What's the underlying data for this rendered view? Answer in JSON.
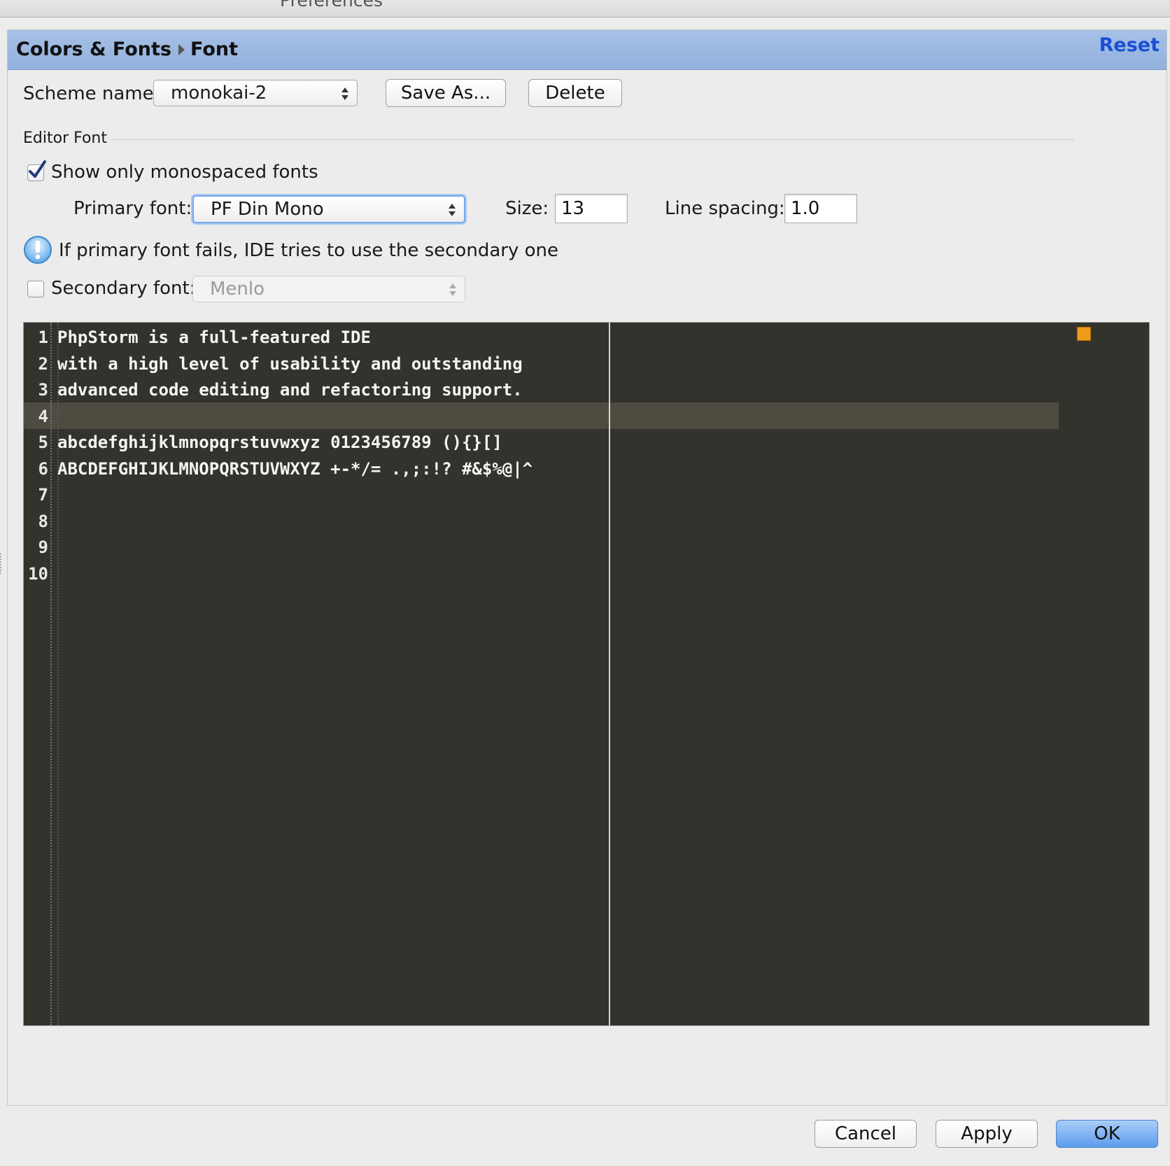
{
  "window": {
    "title": "Preferences"
  },
  "header": {
    "breadcrumb": [
      "Colors & Fonts",
      "Font"
    ],
    "reset_label": "Reset"
  },
  "scheme": {
    "label": "Scheme name:",
    "value": "monokai-2",
    "save_as_label": "Save As...",
    "delete_label": "Delete"
  },
  "editor_font": {
    "section_title": "Editor Font",
    "show_mono_label": "Show only monospaced fonts",
    "show_mono_checked": true,
    "primary_font_label": "Primary font:",
    "primary_font_value": "PF Din Mono",
    "size_label": "Size:",
    "size_value": "13",
    "line_spacing_label": "Line spacing:",
    "line_spacing_value": "1.0",
    "info_text": "If primary font fails, IDE tries to use the secondary one",
    "secondary_font_label": "Secondary font:",
    "secondary_font_checked": false,
    "secondary_font_value": "Menlo"
  },
  "preview": {
    "background": "#32332d",
    "caret_row_color": "#4e4b40",
    "lines": [
      {
        "n": "1",
        "text": "PhpStorm is a full-featured IDE"
      },
      {
        "n": "2",
        "text": "with a high level of usability and outstanding"
      },
      {
        "n": "3",
        "text": "advanced code editing and refactoring support."
      },
      {
        "n": "4",
        "text": ""
      },
      {
        "n": "5",
        "text": "abcdefghijklmnopqrstuvwxyz 0123456789 (){}[]"
      },
      {
        "n": "6",
        "text": "ABCDEFGHIJKLMNOPQRSTUVWXYZ +-*/= .,;:!? #&$%@|^"
      },
      {
        "n": "7",
        "text": ""
      },
      {
        "n": "8",
        "text": ""
      },
      {
        "n": "9",
        "text": ""
      },
      {
        "n": "10",
        "text": ""
      }
    ]
  },
  "footer": {
    "cancel_label": "Cancel",
    "apply_label": "Apply",
    "ok_label": "OK"
  },
  "colors": {
    "accent_link": "#1a4fd6",
    "header_bg": "#9bb8e1",
    "error_marker": "#f19b1c"
  }
}
